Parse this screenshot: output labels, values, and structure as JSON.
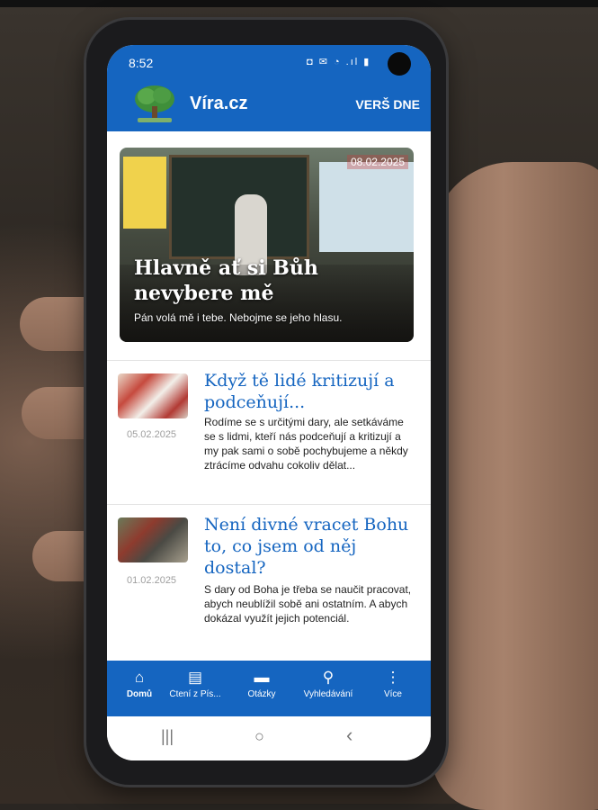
{
  "status_bar": {
    "time": "8:52",
    "icons": "◘ ✉ ◔ .ıl ▮"
  },
  "app_bar": {
    "title": "Víra.cz",
    "verse_of_day": "VERŠ DNE"
  },
  "hero": {
    "date": "08.02.2025",
    "title": "Hlavně ať si Bůh nevybere mě",
    "subtitle": "Pán volá mě i tebe. Nebojme se jeho hlasu."
  },
  "articles": [
    {
      "title": "Když tě lidé kritizují a podceňují...",
      "date": "05.02.2025",
      "excerpt": "Rodíme se s určitými dary, ale setkáváme se s lidmi, kteří nás podceňují a kritizují a my pak sami o sobě pochybujeme a někdy ztrácíme odvahu cokoliv dělat..."
    },
    {
      "title": "Není divné vracet Bohu to, co jsem od něj dostal?",
      "date": "01.02.2025",
      "excerpt": "S dary od Boha je třeba se naučit pracovat, abych neublížil sobě ani ostatním. A abych dokázal využít jejich potenciál."
    }
  ],
  "bottom_nav": [
    {
      "label": "Domů",
      "icon": "home-icon",
      "glyph": "⌂"
    },
    {
      "label": "Čtení z Pís...",
      "icon": "book-icon",
      "glyph": "▤"
    },
    {
      "label": "Otázky",
      "icon": "chat-icon",
      "glyph": "▬"
    },
    {
      "label": "Vyhledávání",
      "icon": "search-icon",
      "glyph": "⚲"
    },
    {
      "label": "Více",
      "icon": "more-icon",
      "glyph": "⋮"
    }
  ],
  "system_nav": {
    "recents": "|||",
    "home": "○",
    "back": "‹"
  },
  "colors": {
    "primary": "#1565c0",
    "link": "#1565c0",
    "muted": "#9e9e9e"
  }
}
